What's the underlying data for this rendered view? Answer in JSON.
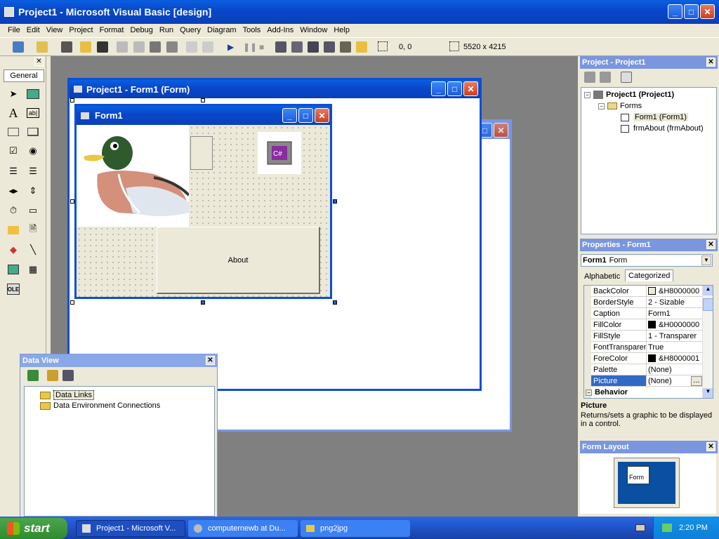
{
  "app": {
    "title": "Project1 - Microsoft Visual Basic [design]"
  },
  "menu": [
    "File",
    "Edit",
    "View",
    "Project",
    "Format",
    "Debug",
    "Run",
    "Query",
    "Diagram",
    "Tools",
    "Add-Ins",
    "Window",
    "Help"
  ],
  "toolbar": {
    "position": "0, 0",
    "size": "5520 x 4215"
  },
  "toolbox": {
    "tab": "General"
  },
  "form_designer": {
    "title": "Project1 - Form1 (Form)",
    "form_caption": "Form1",
    "about_button": "About"
  },
  "project_explorer": {
    "title": "Project - Project1",
    "root": "Project1 (Project1)",
    "folder": "Forms",
    "items": [
      "Form1 (Form1)",
      "frmAbout (frmAbout)"
    ]
  },
  "properties": {
    "title": "Properties - Form1",
    "object": "Form1",
    "object_type": "Form",
    "tabs": [
      "Alphabetic",
      "Categorized"
    ],
    "rows": [
      {
        "name": "BackColor",
        "value": "&H8000000",
        "color": "#ece9d8"
      },
      {
        "name": "BorderStyle",
        "value": "2 - Sizable"
      },
      {
        "name": "Caption",
        "value": "Form1"
      },
      {
        "name": "FillColor",
        "value": "&H0000000",
        "color": "#000000"
      },
      {
        "name": "FillStyle",
        "value": "1 - Transparer"
      },
      {
        "name": "FontTransparen",
        "value": "True"
      },
      {
        "name": "ForeColor",
        "value": "&H8000001",
        "color": "#000000"
      },
      {
        "name": "Palette",
        "value": "(None)"
      },
      {
        "name": "Picture",
        "value": "(None)"
      }
    ],
    "category": "Behavior",
    "desc_title": "Picture",
    "desc_text": "Returns/sets a graphic to be displayed in a control."
  },
  "form_layout": {
    "title": "Form Layout",
    "label": "Form"
  },
  "data_view": {
    "title": "Data View",
    "items": [
      "Data Links",
      "Data Environment Connections"
    ]
  },
  "taskbar": {
    "start": "start",
    "buttons": [
      "Project1 - Microsoft V...",
      "computernewb at Du...",
      "png2jpg"
    ],
    "clock": "2:20 PM"
  }
}
